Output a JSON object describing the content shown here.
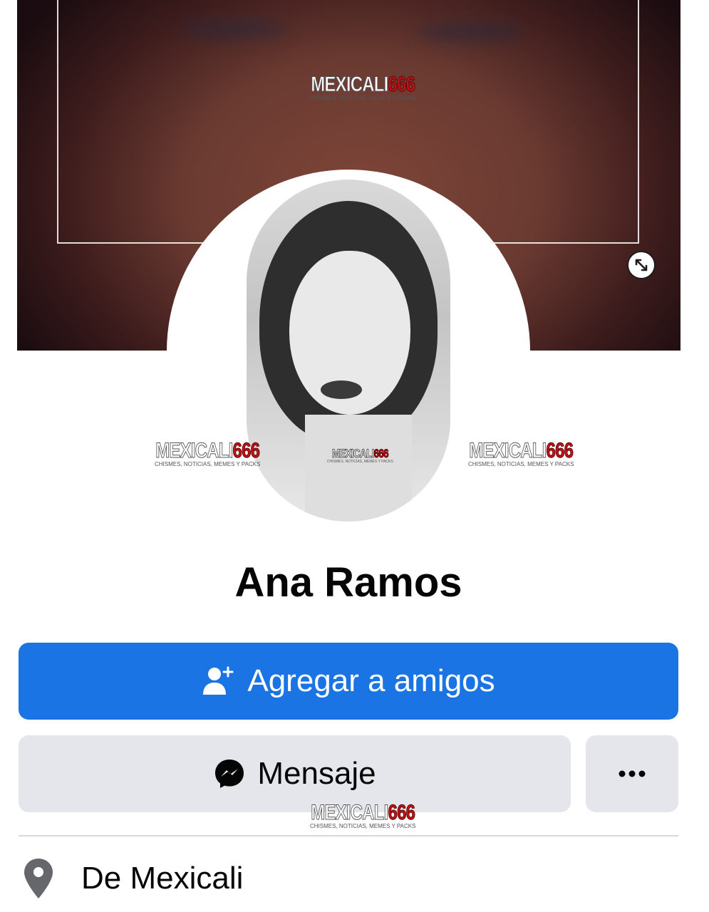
{
  "profile": {
    "name": "Ana Ramos",
    "location": "De Mexicali"
  },
  "watermark": {
    "brand": "MEXICALI",
    "number": "666",
    "tagline": "CHISMES, NOTICIAS, MEMES Y PACKS"
  },
  "actions": {
    "add_friend_label": "Agregar a amigos",
    "message_label": "Mensaje",
    "more_label": "..."
  },
  "icons": {
    "add_friend": "person-add-icon",
    "message": "messenger-icon",
    "more": "more-dots-icon",
    "location": "location-pin-icon",
    "resize": "resize-arrows-icon"
  },
  "colors": {
    "primary": "#1b74e4",
    "secondary_button": "#e4e6eb",
    "text": "#050505",
    "watermark_red": "#c0141b"
  }
}
